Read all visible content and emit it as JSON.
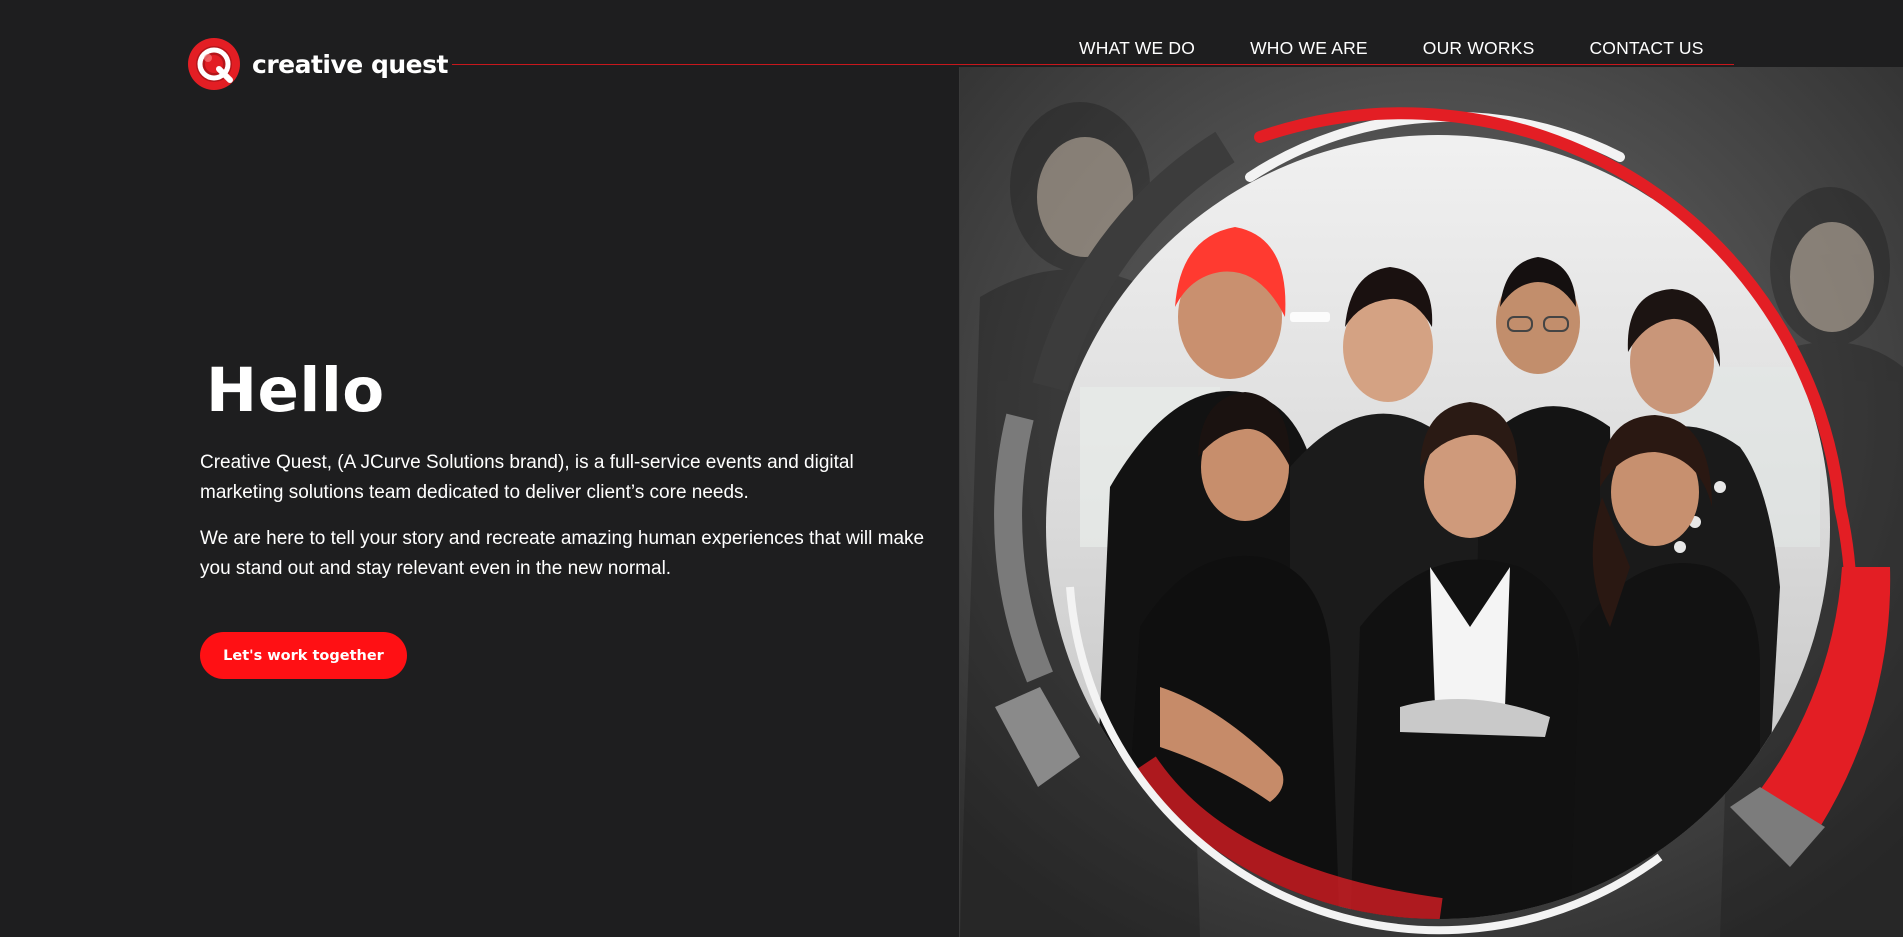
{
  "brand": {
    "name": "creative quest",
    "accent_color": "#ff1014",
    "rule_color": "#c8171c"
  },
  "nav": {
    "items": [
      {
        "label": "WHAT WE DO"
      },
      {
        "label": "WHO WE ARE"
      },
      {
        "label": "OUR WORKS"
      },
      {
        "label": "CONTACT US"
      }
    ]
  },
  "hero": {
    "title": "Hello",
    "paragraph_1": "Creative Quest, (A JCurve Solutions brand), is a full-service events and digital marketing solutions team dedicated to deliver client’s core needs.",
    "paragraph_2": "We are here to tell your story and recreate amazing human experiences that will make you stand out and stay relevant even in the new normal.",
    "cta_label": "Let's work together"
  },
  "visual": {
    "background_color": "#1e1e1f",
    "photo_icon": "team-photo",
    "ring_colors": [
      "#e31e24",
      "#ffffff",
      "#4a4a4a",
      "#6b6b6b"
    ]
  }
}
